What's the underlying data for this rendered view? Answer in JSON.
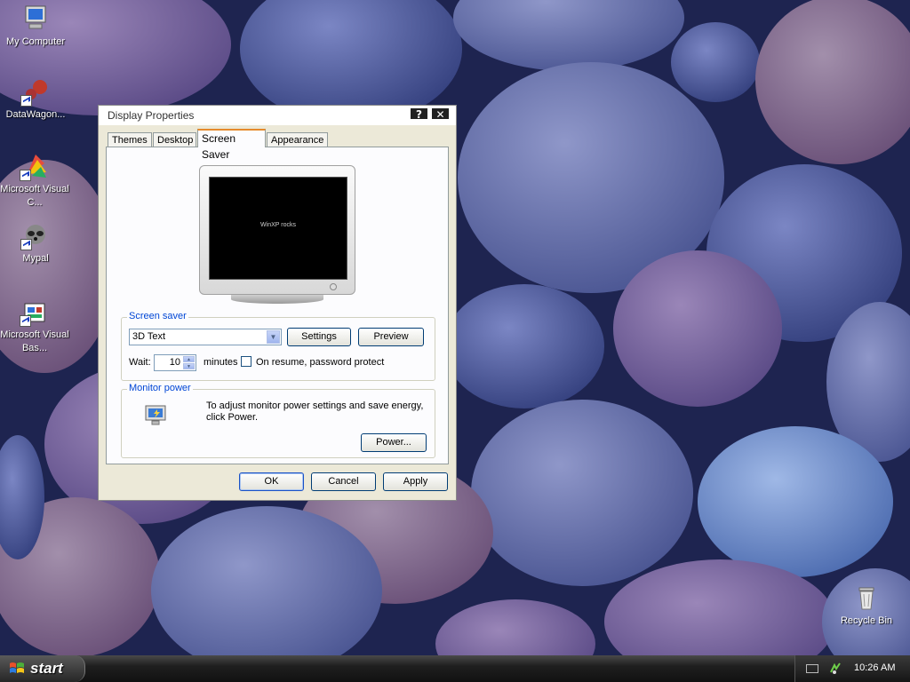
{
  "desktop": {
    "icons": [
      {
        "label": "My Computer"
      },
      {
        "label": "DataWagon..."
      },
      {
        "label": "Microsoft Visual C..."
      },
      {
        "label": "Mypal"
      },
      {
        "label": "Microsoft Visual Bas..."
      },
      {
        "label": "Recycle Bin"
      }
    ]
  },
  "window": {
    "title": "Display Properties",
    "help_glyph": "?",
    "close_glyph": "✕",
    "tabs": [
      {
        "label": "Themes"
      },
      {
        "label": "Desktop"
      },
      {
        "label": "Screen Saver"
      },
      {
        "label": "Appearance"
      }
    ],
    "active_tab": "Screen Saver",
    "preview_text": "WinXP rocks",
    "screen_saver": {
      "group_label": "Screen saver",
      "selected": "3D Text",
      "settings_label": "Settings",
      "preview_label": "Preview",
      "wait_label": "Wait:",
      "wait_value": "10",
      "minutes_label": "minutes",
      "password_label": "On resume, password protect",
      "password_checked": false
    },
    "monitor_power": {
      "group_label": "Monitor power",
      "text": "To adjust monitor power settings and save energy, click Power.",
      "power_label": "Power..."
    },
    "ok_label": "OK",
    "cancel_label": "Cancel",
    "apply_label": "Apply"
  },
  "taskbar": {
    "start_label": "start",
    "clock": "10:26 AM"
  },
  "colors": {
    "accent_group_label": "#0046d5",
    "tab_highlight": "#e68b2c"
  }
}
